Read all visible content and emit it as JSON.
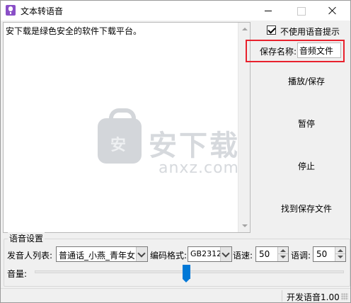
{
  "window": {
    "title": "文本转语音"
  },
  "editor": {
    "text": "安下载是绿色安全的软件下载平台。"
  },
  "watermark": {
    "bag_char": "安",
    "big": "安下载",
    "small": "anxz.com"
  },
  "options": {
    "no_voice_prompt_label": "不使用语音提示",
    "no_voice_prompt_checked": true
  },
  "save_name": {
    "label": "保存名称:",
    "value": "音频文件"
  },
  "actions": {
    "play_save": "播放/保存",
    "pause": "暂停",
    "stop": "停止",
    "find_saved": "找到保存文件"
  },
  "voice_settings": {
    "group_title": "语音设置",
    "speaker_label": "发音人列表:",
    "speaker_value": "普通话_小燕_青年女",
    "encoding_label": "编码格式:",
    "encoding_value": "GB2312",
    "speed_label": "语速:",
    "speed_value": "50",
    "pitch_label": "语调:",
    "pitch_value": "50",
    "volume_label": "音量:",
    "volume_level_fraction": 0.49
  },
  "status": {
    "text": "开发语音1.00"
  },
  "colors": {
    "highlight_box": "#e8212d",
    "slider_thumb": "#0078d7",
    "app_icon": "#8a4fc7"
  }
}
